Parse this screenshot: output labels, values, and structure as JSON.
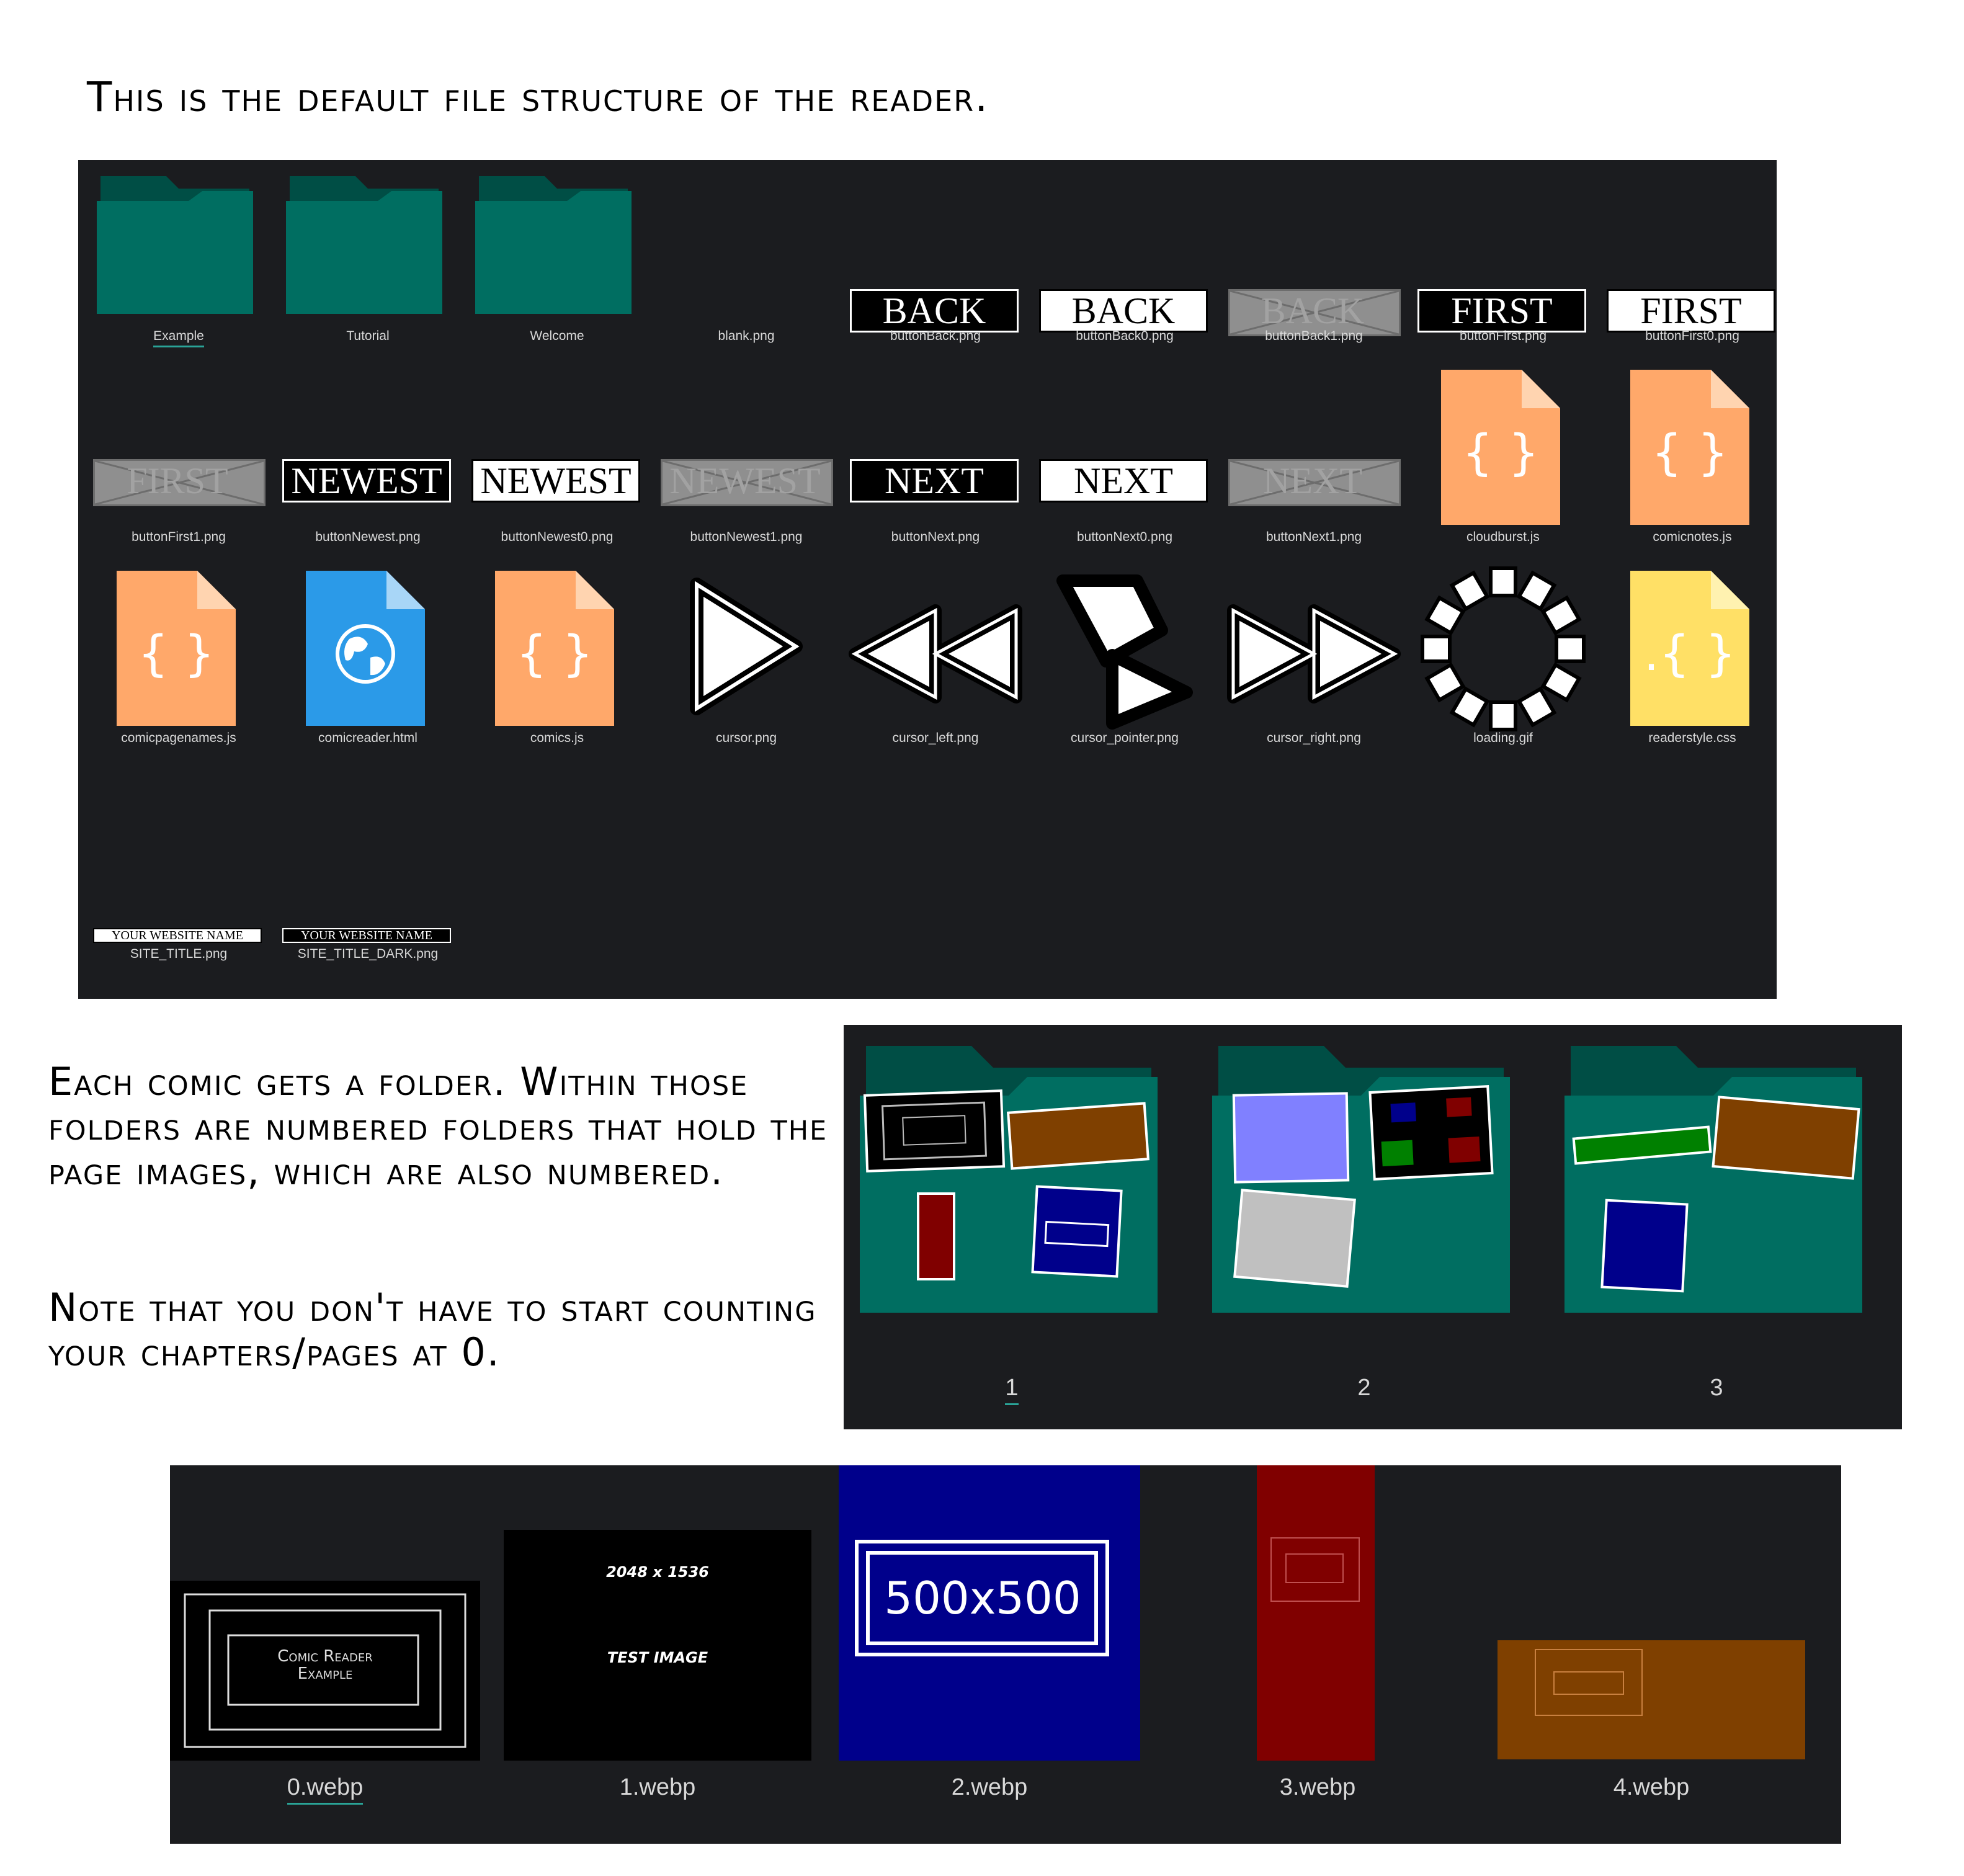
{
  "intro_text": "This is the default file structure of the reader.",
  "explain_text": "Each comic gets a folder. Within those folders are numbered folders that hold the page images, which are also numbered.",
  "note_text": "Note that you don't have to start counting your chapters/pages at 0.",
  "root_files": [
    {
      "name": "Example",
      "kind": "folder"
    },
    {
      "name": "Tutorial",
      "kind": "folder"
    },
    {
      "name": "Welcome",
      "kind": "folder"
    },
    {
      "name": "blank.png",
      "kind": "blank"
    },
    {
      "name": "buttonBack.png",
      "kind": "button",
      "text": "BACK",
      "style": "dark"
    },
    {
      "name": "buttonBack0.png",
      "kind": "button",
      "text": "BACK",
      "style": "light"
    },
    {
      "name": "buttonBack1.png",
      "kind": "button",
      "text": "BACK",
      "style": "disabled"
    },
    {
      "name": "buttonFirst.png",
      "kind": "button",
      "text": "FIRST",
      "style": "dark"
    },
    {
      "name": "buttonFirst0.png",
      "kind": "button",
      "text": "FIRST",
      "style": "light"
    },
    {
      "name": "buttonFirst1.png",
      "kind": "button",
      "text": "FIRST",
      "style": "disabled"
    },
    {
      "name": "buttonNewest.png",
      "kind": "button",
      "text": "NEWEST",
      "style": "dark"
    },
    {
      "name": "buttonNewest0.png",
      "kind": "button",
      "text": "NEWEST",
      "style": "light"
    },
    {
      "name": "buttonNewest1.png",
      "kind": "button",
      "text": "NEWEST",
      "style": "disabled"
    },
    {
      "name": "buttonNext.png",
      "kind": "button",
      "text": "NEXT",
      "style": "dark"
    },
    {
      "name": "buttonNext0.png",
      "kind": "button",
      "text": "NEXT",
      "style": "light"
    },
    {
      "name": "buttonNext1.png",
      "kind": "button",
      "text": "NEXT",
      "style": "disabled"
    },
    {
      "name": "cloudburst.js",
      "kind": "js"
    },
    {
      "name": "comicnotes.js",
      "kind": "js"
    },
    {
      "name": "comicpagenames.js",
      "kind": "js"
    },
    {
      "name": "comicreader.html",
      "kind": "html"
    },
    {
      "name": "comics.js",
      "kind": "js"
    },
    {
      "name": "cursor.png",
      "kind": "cursor"
    },
    {
      "name": "cursor_left.png",
      "kind": "cursor_left"
    },
    {
      "name": "cursor_pointer.png",
      "kind": "cursor_pointer"
    },
    {
      "name": "cursor_right.png",
      "kind": "cursor_right"
    },
    {
      "name": "loading.gif",
      "kind": "loading"
    },
    {
      "name": "readerstyle.css",
      "kind": "css"
    },
    {
      "name": "SITE_TITLE.png",
      "kind": "title",
      "text": "YOUR WEBSITE NAME",
      "style": "light"
    },
    {
      "name": "SITE_TITLE_DARK.png",
      "kind": "title",
      "text": "YOUR WEBSITE NAME",
      "style": "dark"
    }
  ],
  "chapter_folders": [
    {
      "name": "1"
    },
    {
      "name": "2"
    },
    {
      "name": "3"
    }
  ],
  "page_images": [
    {
      "name": "0.webp",
      "text": "Comic Reader Example"
    },
    {
      "name": "1.webp",
      "text_top": "2048 x 1536",
      "text_bottom": "Test Image"
    },
    {
      "name": "2.webp",
      "text": "500x500"
    },
    {
      "name": "3.webp"
    },
    {
      "name": "4.webp"
    }
  ],
  "colors": {
    "panel_bg": "#1b1c1f",
    "folder_front": "#006e61",
    "folder_back": "#004e45",
    "selection_accent": "#2aa397",
    "js_icon": "#ffa86a",
    "css_icon": "#ffe066",
    "html_icon": "#2b9ae8"
  }
}
